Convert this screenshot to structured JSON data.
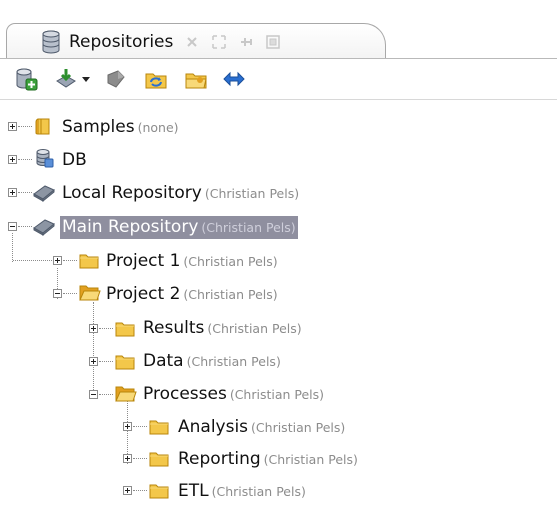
{
  "view": {
    "tab_title": "Repositories",
    "tab_buttons": [
      "close-icon",
      "maximize-icon",
      "pin-icon",
      "minimize-icon"
    ]
  },
  "toolbar": {
    "buttons": [
      {
        "name": "add-repository-icon"
      },
      {
        "name": "import-icon",
        "has_dropdown": true
      },
      {
        "name": "store-icon"
      },
      {
        "name": "refresh-icon"
      },
      {
        "name": "open-folder-icon"
      },
      {
        "name": "link-editor-icon"
      }
    ]
  },
  "tree": {
    "nodes": [
      {
        "label": "Samples",
        "owner": "(none)",
        "depth": 0,
        "expanded": false,
        "icon": "samples-icon"
      },
      {
        "label": "DB",
        "owner": "",
        "depth": 0,
        "expanded": false,
        "icon": "database-icon"
      },
      {
        "label": "Local Repository",
        "owner": "(Christian Pels)",
        "depth": 0,
        "expanded": false,
        "icon": "repository-icon"
      },
      {
        "label": "Main Repository",
        "owner": "(Christian Pels)",
        "depth": 0,
        "expanded": true,
        "icon": "repository-icon",
        "selected": true
      },
      {
        "label": "Project 1",
        "owner": "(Christian Pels)",
        "depth": 1,
        "expanded": false,
        "icon": "folder-icon"
      },
      {
        "label": "Project 2",
        "owner": "(Christian Pels)",
        "depth": 1,
        "expanded": true,
        "icon": "folder-open-icon"
      },
      {
        "label": "Results",
        "owner": "(Christian Pels)",
        "depth": 2,
        "expanded": false,
        "icon": "folder-icon"
      },
      {
        "label": "Data",
        "owner": "(Christian Pels)",
        "depth": 2,
        "expanded": false,
        "icon": "folder-icon"
      },
      {
        "label": "Processes",
        "owner": "(Christian Pels)",
        "depth": 2,
        "expanded": true,
        "icon": "folder-open-icon"
      },
      {
        "label": "Analysis",
        "owner": "(Christian Pels)",
        "depth": 3,
        "expanded": false,
        "icon": "folder-icon"
      },
      {
        "label": "Reporting",
        "owner": "(Christian Pels)",
        "depth": 3,
        "expanded": false,
        "icon": "folder-icon"
      },
      {
        "label": "ETL",
        "owner": "(Christian Pels)",
        "depth": 3,
        "expanded": false,
        "icon": "folder-icon"
      }
    ]
  },
  "colors": {
    "selection_bg": "#8f8f9f",
    "owner_text": "#8c8c8c",
    "folder": "#f3c74a"
  }
}
